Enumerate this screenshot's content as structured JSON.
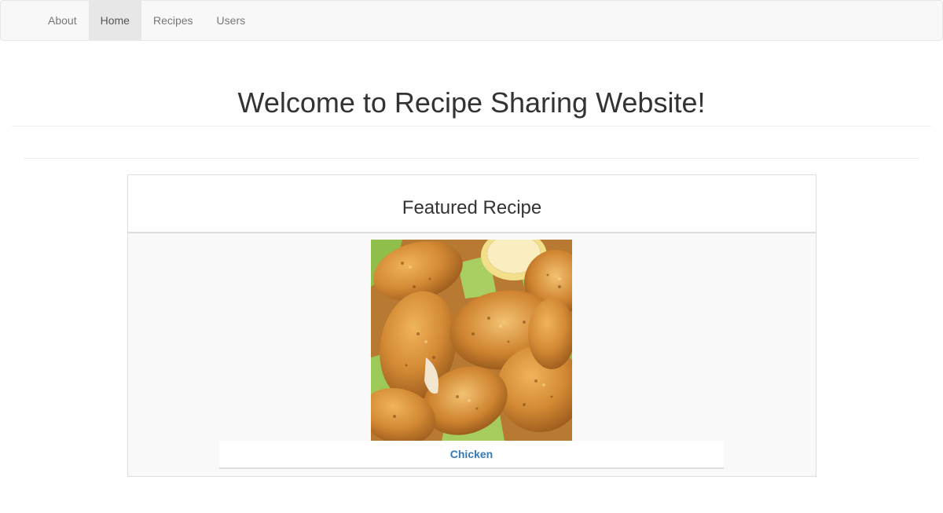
{
  "nav": {
    "items": [
      {
        "label": "About",
        "active": false
      },
      {
        "label": "Home",
        "active": true
      },
      {
        "label": "Recipes",
        "active": false
      },
      {
        "label": "Users",
        "active": false
      }
    ]
  },
  "page": {
    "title": "Welcome to Recipe Sharing Website!"
  },
  "featured": {
    "heading": "Featured Recipe",
    "recipe_name": "Chicken",
    "image": "fried-chicken-tenders-photo"
  },
  "colors": {
    "navbar_bg": "#f8f8f8",
    "active_tab_bg": "#e7e7e7",
    "link": "#337ab7"
  }
}
